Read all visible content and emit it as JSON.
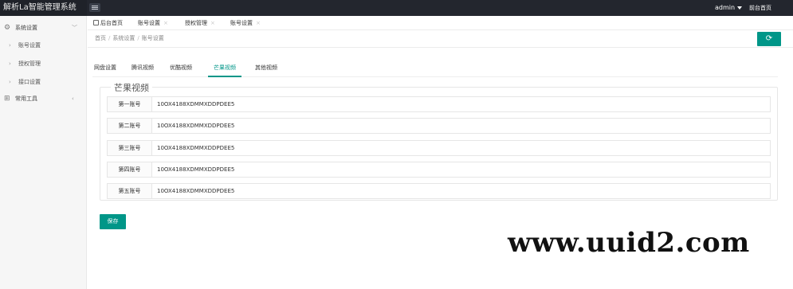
{
  "app": {
    "title": "解析La智能管理系统"
  },
  "header": {
    "user": "admin",
    "front_link": "前台首页",
    "colors": {
      "bar": "#23262e",
      "accent": "#009688"
    }
  },
  "sidebar": {
    "groups": [
      {
        "label": "系统设置",
        "icon": "gear-icon",
        "expanded": true,
        "items": [
          {
            "label": "账号设置"
          },
          {
            "label": "授权管理"
          },
          {
            "label": "接口设置"
          }
        ]
      },
      {
        "label": "常用工具",
        "icon": "grid-icon",
        "expanded": false,
        "items": []
      }
    ]
  },
  "tabs": [
    {
      "label": "后台首页",
      "icon": "home-icon",
      "closable": false
    },
    {
      "label": "账号设置",
      "closable": true
    },
    {
      "label": "授权管理",
      "closable": true
    },
    {
      "label": "账号设置",
      "closable": true
    }
  ],
  "breadcrumb": [
    "首页",
    "系统设置",
    "账号设置"
  ],
  "subtabs": {
    "active_index": 3,
    "items": [
      "网盘设置",
      "腾讯视频",
      "优酷视频",
      "芒果视频",
      "其他视频"
    ]
  },
  "form": {
    "legend": "芒果视频",
    "rows": [
      {
        "label": "第一账号",
        "value": "10OX4188XDMMXDDPDEE5"
      },
      {
        "label": "第二账号",
        "value": "10OX4188XDMMXDDPDEE5"
      },
      {
        "label": "第三账号",
        "value": "10OX4188XDMMXDDPDEE5"
      },
      {
        "label": "第四账号",
        "value": "10OX4188XDMMXDDPDEE5"
      },
      {
        "label": "第五账号",
        "value": "10OX4188XDMMXDDPDEE5"
      }
    ],
    "save_label": "保存"
  },
  "watermark": "www.uuid2.com"
}
